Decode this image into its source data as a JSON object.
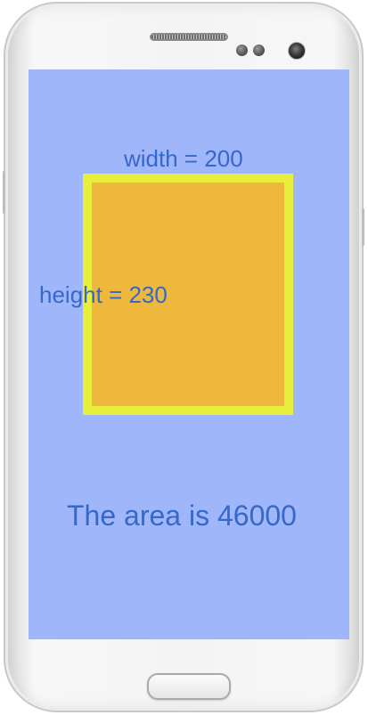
{
  "device": {
    "type": "android-phone",
    "screen_background": "#9fb7fa"
  },
  "shape": {
    "border_color": "#e8ee3c",
    "fill_color": "#eeb83c"
  },
  "labels": {
    "width_text": "width = 200",
    "height_text": "height = 230",
    "area_text": "The area is 46000",
    "text_color": "#3568c8"
  }
}
